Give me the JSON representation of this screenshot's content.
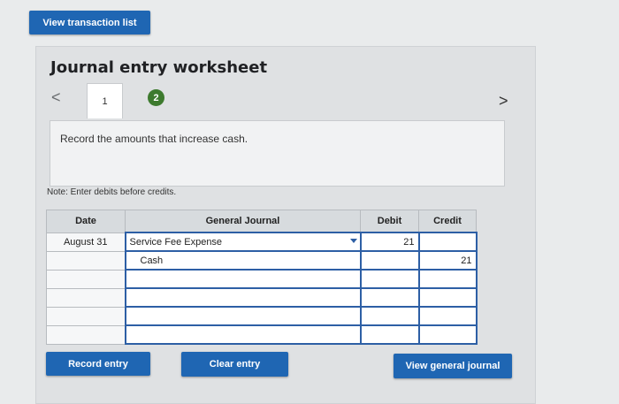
{
  "top": {
    "view_transaction_label": "View transaction list"
  },
  "worksheet": {
    "title": "Journal entry worksheet",
    "nav_prev": "<",
    "nav_next": ">",
    "tabs": [
      {
        "label": "1"
      },
      {
        "label": "2"
      }
    ],
    "instruction": "Record the amounts that increase cash.",
    "note": "Note: Enter debits before credits."
  },
  "table": {
    "headers": {
      "date": "Date",
      "general_journal": "General Journal",
      "debit": "Debit",
      "credit": "Credit"
    },
    "rows": [
      {
        "date": "August 31",
        "account": "Service Fee Expense",
        "debit": "21",
        "credit": ""
      },
      {
        "date": "",
        "account": "Cash",
        "debit": "",
        "credit": "21"
      },
      {
        "date": "",
        "account": "",
        "debit": "",
        "credit": ""
      },
      {
        "date": "",
        "account": "",
        "debit": "",
        "credit": ""
      },
      {
        "date": "",
        "account": "",
        "debit": "",
        "credit": ""
      },
      {
        "date": "",
        "account": "",
        "debit": "",
        "credit": ""
      }
    ]
  },
  "buttons": {
    "record_entry": "Record entry",
    "clear_entry": "Clear entry",
    "view_general_journal": "View general journal"
  },
  "colors": {
    "button_blue": "#1f66b3",
    "tab_active_green": "#3d7a2e",
    "input_border": "#2d5fa5"
  }
}
